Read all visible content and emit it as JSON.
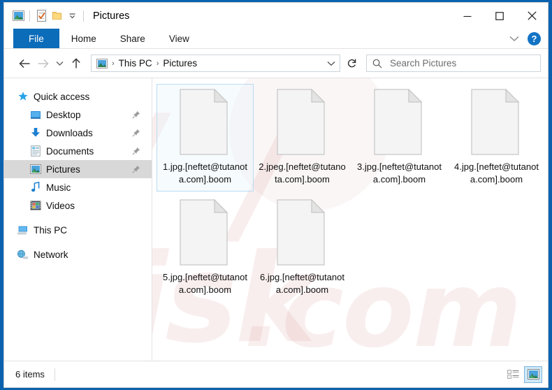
{
  "window": {
    "title": "Pictures",
    "accent_color": "#0a62ae",
    "quick_access": [
      {
        "name": "pictures-folder-icon",
        "label": "Pictures"
      },
      {
        "name": "properties-icon",
        "label": "Properties"
      },
      {
        "name": "new-folder-icon",
        "label": "New folder"
      },
      {
        "name": "customize-qat-chevron-icon",
        "label": "Customize Quick Access Toolbar"
      }
    ],
    "controls": {
      "minimize": "Minimize",
      "maximize": "Maximize",
      "close": "Close"
    }
  },
  "ribbon": {
    "tabs": [
      {
        "label": "File",
        "active": true
      },
      {
        "label": "Home",
        "active": false
      },
      {
        "label": "Share",
        "active": false
      },
      {
        "label": "View",
        "active": false
      }
    ],
    "expand_label": "Expand the Ribbon",
    "help_label": "?"
  },
  "navigation": {
    "back_label": "Back",
    "forward_label": "Forward",
    "recent_label": "Recent locations",
    "up_label": "Up",
    "refresh_label": "Refresh",
    "breadcrumbs": [
      "This PC",
      "Pictures"
    ],
    "breadcrumb_separator": "›",
    "address_chevron_label": "Previous locations"
  },
  "search": {
    "placeholder": "Search Pictures",
    "value": "",
    "icon": "search-icon"
  },
  "sidebar": {
    "items": [
      {
        "label": "Quick access",
        "icon": "star-icon",
        "level": 1,
        "pinned": false,
        "selected": false
      },
      {
        "label": "Desktop",
        "icon": "desktop-icon",
        "level": 2,
        "pinned": true,
        "selected": false
      },
      {
        "label": "Downloads",
        "icon": "downloads-icon",
        "level": 2,
        "pinned": true,
        "selected": false
      },
      {
        "label": "Documents",
        "icon": "documents-icon",
        "level": 2,
        "pinned": true,
        "selected": false
      },
      {
        "label": "Pictures",
        "icon": "pictures-icon",
        "level": 2,
        "pinned": true,
        "selected": true
      },
      {
        "label": "Music",
        "icon": "music-icon",
        "level": 2,
        "pinned": false,
        "selected": false
      },
      {
        "label": "Videos",
        "icon": "videos-icon",
        "level": 2,
        "pinned": false,
        "selected": false
      },
      {
        "label": "This PC",
        "icon": "this-pc-icon",
        "level": 1,
        "pinned": false,
        "selected": false
      },
      {
        "label": "Network",
        "icon": "network-icon",
        "level": 1,
        "pinned": false,
        "selected": false
      }
    ]
  },
  "files": [
    {
      "name": "1.jpg.[neftet@tutanota.com].boom",
      "icon": "generic-file-icon",
      "selected": true
    },
    {
      "name": "2.jpeg.[neftet@tutanota.com].boom",
      "icon": "generic-file-icon",
      "selected": false
    },
    {
      "name": "3.jpg.[neftet@tutanota.com].boom",
      "icon": "generic-file-icon",
      "selected": false
    },
    {
      "name": "4.jpg.[neftet@tutanota.com].boom",
      "icon": "generic-file-icon",
      "selected": false
    },
    {
      "name": "5.jpg.[neftet@tutanota.com].boom",
      "icon": "generic-file-icon",
      "selected": false
    },
    {
      "name": "6.jpg.[neftet@tutanota.com].boom",
      "icon": "generic-file-icon",
      "selected": false
    }
  ],
  "statusbar": {
    "item_count_text": "6 items",
    "view_buttons": [
      {
        "name": "details-view-button",
        "label": "Details view",
        "active": false
      },
      {
        "name": "large-icons-view-button",
        "label": "Large icons view",
        "active": true
      }
    ]
  },
  "watermark": {
    "text": "risk",
    "suffix": ".com"
  }
}
